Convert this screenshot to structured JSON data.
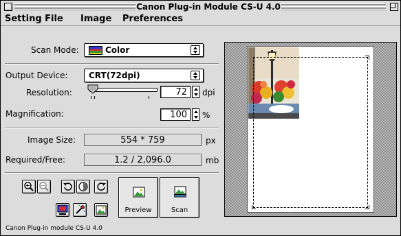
{
  "window": {
    "title": "Canon Plug-in Module CS-U 4.0"
  },
  "menu": [
    "Setting File",
    "Image",
    "Preferences"
  ],
  "scan_mode": {
    "label": "Scan Mode:",
    "value": "Color"
  },
  "output_device": {
    "label": "Output Device:",
    "value": "CRT(72dpi)"
  },
  "resolution": {
    "label": "Resolution:",
    "value": "72",
    "unit": "dpi"
  },
  "magnification": {
    "label": "Magnification:",
    "value": "100",
    "unit": "%"
  },
  "image_size": {
    "label": "Image Size:",
    "value": "554 * 759",
    "unit": "px"
  },
  "required_free": {
    "label": "Required/Free:",
    "value": "1.2 / 2,096.0",
    "unit": "mb"
  },
  "buttons": {
    "preview": "Preview",
    "scan": "Scan"
  },
  "status": "Canon Plug-in module CS-U 4.0"
}
